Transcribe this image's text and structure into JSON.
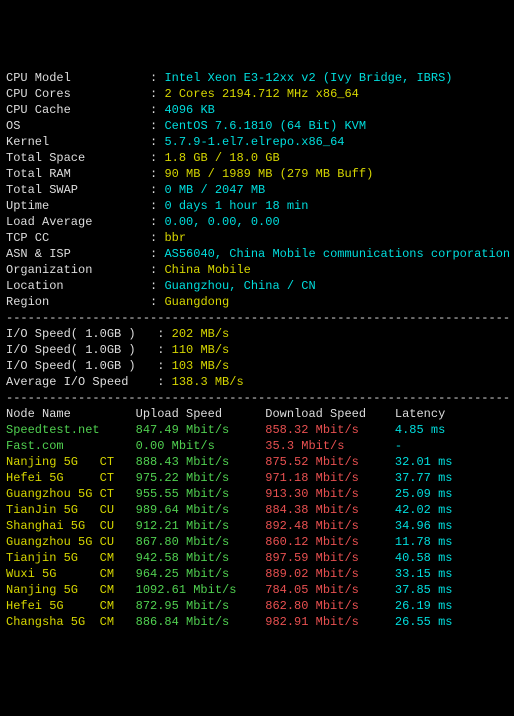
{
  "sysinfo": [
    {
      "label": "CPU Model",
      "value": "Intel Xeon E3-12xx v2 (Ivy Bridge, IBRS)",
      "cls": "cyan"
    },
    {
      "label": "CPU Cores",
      "value": "2 Cores 2194.712 MHz x86_64",
      "cls": "yellow"
    },
    {
      "label": "CPU Cache",
      "value": "4096 KB",
      "cls": "cyan"
    },
    {
      "label": "OS",
      "value": "CentOS 7.6.1810 (64 Bit) KVM",
      "cls": "cyan"
    },
    {
      "label": "Kernel",
      "value": "5.7.9-1.el7.elrepo.x86_64",
      "cls": "cyan"
    },
    {
      "label": "Total Space",
      "value": "1.8 GB / 18.0 GB",
      "cls": "yellow"
    },
    {
      "label": "Total RAM",
      "value": "90 MB / 1989 MB (279 MB Buff)",
      "cls": "yellow"
    },
    {
      "label": "Total SWAP",
      "value": "0 MB / 2047 MB",
      "cls": "cyan"
    },
    {
      "label": "Uptime",
      "value": "0 days 1 hour 18 min",
      "cls": "cyan"
    },
    {
      "label": "Load Average",
      "value": "0.00, 0.00, 0.00",
      "cls": "cyan"
    },
    {
      "label": "TCP CC",
      "value": "bbr",
      "cls": "yellow"
    },
    {
      "label": "ASN & ISP",
      "value": "AS56040, China Mobile communications corporation",
      "cls": "cyan"
    },
    {
      "label": "Organization",
      "value": "China Mobile",
      "cls": "yellow"
    },
    {
      "label": "Location",
      "value": "Guangzhou, China / CN",
      "cls": "cyan"
    },
    {
      "label": "Region",
      "value": "Guangdong",
      "cls": "yellow"
    }
  ],
  "io": [
    {
      "label": "I/O Speed( 1.0GB )",
      "value": "202 MB/s",
      "cls": "yellow"
    },
    {
      "label": "I/O Speed( 1.0GB )",
      "value": "110 MB/s",
      "cls": "yellow"
    },
    {
      "label": "I/O Speed( 1.0GB )",
      "value": "103 MB/s",
      "cls": "yellow"
    },
    {
      "label": "Average I/O Speed",
      "value": "138.3 MB/s",
      "cls": "yellow"
    }
  ],
  "headers": {
    "node": "Node Name",
    "up": "Upload Speed",
    "down": "Download Speed",
    "lat": "Latency"
  },
  "speed": [
    {
      "node": "Speedtest.net",
      "ncls": "green",
      "up": "847.49 Mbit/s",
      "down": "858.32 Mbit/s",
      "lat": "4.85 ms"
    },
    {
      "node": "Fast.com",
      "ncls": "green",
      "up": "0.00 Mbit/s",
      "down": "35.3 Mbit/s",
      "lat": "-"
    },
    {
      "node": "Nanjing 5G   CT",
      "ncls": "yellow",
      "up": "888.43 Mbit/s",
      "down": "875.52 Mbit/s",
      "lat": "32.01 ms"
    },
    {
      "node": "Hefei 5G     CT",
      "ncls": "yellow",
      "up": "975.22 Mbit/s",
      "down": "971.18 Mbit/s",
      "lat": "37.77 ms"
    },
    {
      "node": "Guangzhou 5G CT",
      "ncls": "yellow",
      "up": "955.55 Mbit/s",
      "down": "913.30 Mbit/s",
      "lat": "25.09 ms"
    },
    {
      "node": "TianJin 5G   CU",
      "ncls": "yellow",
      "up": "989.64 Mbit/s",
      "down": "884.38 Mbit/s",
      "lat": "42.02 ms"
    },
    {
      "node": "Shanghai 5G  CU",
      "ncls": "yellow",
      "up": "912.21 Mbit/s",
      "down": "892.48 Mbit/s",
      "lat": "34.96 ms"
    },
    {
      "node": "Guangzhou 5G CU",
      "ncls": "yellow",
      "up": "867.80 Mbit/s",
      "down": "860.12 Mbit/s",
      "lat": "11.78 ms"
    },
    {
      "node": "Tianjin 5G   CM",
      "ncls": "yellow",
      "up": "942.58 Mbit/s",
      "down": "897.59 Mbit/s",
      "lat": "40.58 ms"
    },
    {
      "node": "Wuxi 5G      CM",
      "ncls": "yellow",
      "up": "964.25 Mbit/s",
      "down": "889.02 Mbit/s",
      "lat": "33.15 ms"
    },
    {
      "node": "Nanjing 5G   CM",
      "ncls": "yellow",
      "up": "1092.61 Mbit/s",
      "down": "784.05 Mbit/s",
      "lat": "37.85 ms"
    },
    {
      "node": "Hefei 5G     CM",
      "ncls": "yellow",
      "up": "872.95 Mbit/s",
      "down": "862.80 Mbit/s",
      "lat": "26.19 ms"
    },
    {
      "node": "Changsha 5G  CM",
      "ncls": "yellow",
      "up": "886.84 Mbit/s",
      "down": "982.91 Mbit/s",
      "lat": "26.55 ms"
    }
  ],
  "divider": "----------------------------------------------------------------------"
}
